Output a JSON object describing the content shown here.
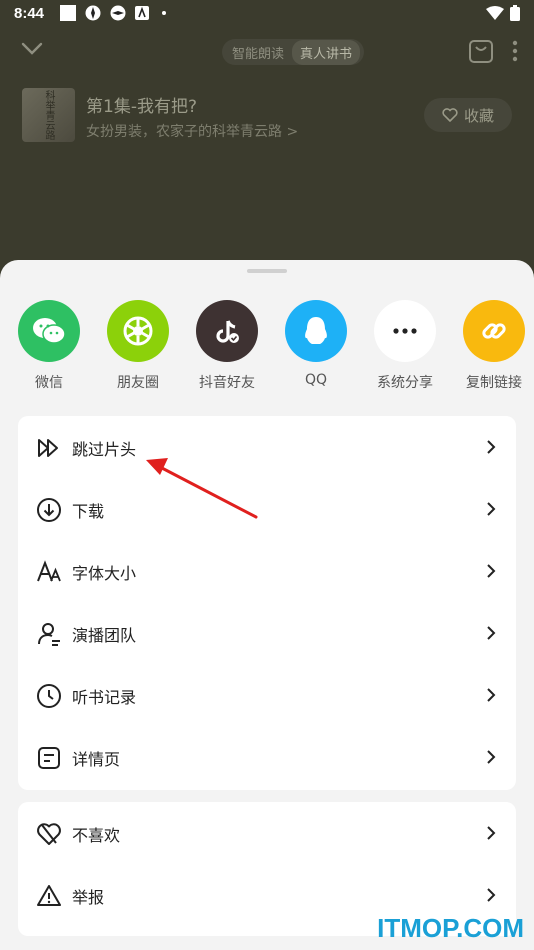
{
  "status_bar": {
    "time": "8:44"
  },
  "player": {
    "modes": [
      "智能朗读",
      "真人讲书"
    ],
    "book_title": "第1集-我有把?",
    "book_subtitle": "女扮男装，农家子的科举青云路",
    "subtitle_chevron": ">",
    "cover_text": "科举青云路",
    "favorite_label": "收藏"
  },
  "share_targets": [
    {
      "label": "微信",
      "color": "#2ec063",
      "icon": "wechat-icon"
    },
    {
      "label": "朋友圈",
      "color": "#8cd10a",
      "icon": "moments-icon"
    },
    {
      "label": "抖音好友",
      "color": "#3e3232",
      "icon": "douyin-icon"
    },
    {
      "label": "QQ",
      "color": "#1eb1f6",
      "icon": "qq-icon"
    },
    {
      "label": "系统分享",
      "color": "#ffffff",
      "icon": "more-icon"
    },
    {
      "label": "复制链接",
      "color": "#f9b90e",
      "icon": "link-icon"
    }
  ],
  "menu": [
    {
      "label": "跳过片头",
      "icon": "skip-intro-icon"
    },
    {
      "label": "下载",
      "icon": "download-icon"
    },
    {
      "label": "字体大小",
      "icon": "font-size-icon"
    },
    {
      "label": "演播团队",
      "icon": "team-icon"
    },
    {
      "label": "听书记录",
      "icon": "history-icon"
    },
    {
      "label": "详情页",
      "icon": "detail-icon"
    }
  ],
  "menu2": [
    {
      "label": "不喜欢",
      "icon": "dislike-icon"
    },
    {
      "label": "举报",
      "icon": "report-icon"
    }
  ],
  "watermark": "ITMOP.COM",
  "colors": {
    "annotation_arrow": "#e0201e",
    "watermark": "#1aa0d6"
  }
}
